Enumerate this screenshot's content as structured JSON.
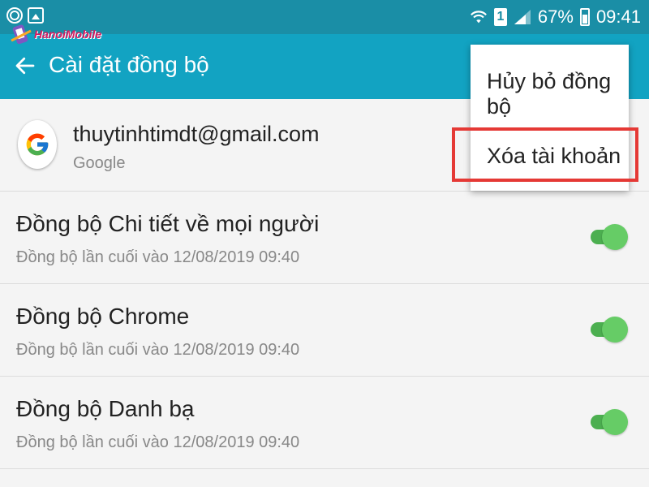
{
  "status_bar": {
    "sim_label": "1",
    "battery": "67%",
    "time": "09:41"
  },
  "watermark": {
    "text": "HanoiMobile"
  },
  "toolbar": {
    "title": "Cài đặt đồng bộ"
  },
  "account": {
    "email": "thuytinhtimdt@gmail.com",
    "type": "Google"
  },
  "sync_items": [
    {
      "title": "Đồng bộ Chi tiết về mọi người",
      "last_sync": "Đồng bộ lần cuối vào 12/08/2019  09:40",
      "enabled": true
    },
    {
      "title": "Đồng bộ Chrome",
      "last_sync": "Đồng bộ lần cuối vào 12/08/2019  09:40",
      "enabled": true
    },
    {
      "title": "Đồng bộ Danh bạ",
      "last_sync": "Đồng bộ lần cuối vào 12/08/2019  09:40",
      "enabled": true
    }
  ],
  "menu": {
    "cancel_sync": "Hủy bỏ đồng bộ",
    "remove_account": "Xóa tài khoản"
  },
  "colors": {
    "status_bar": "#1a8ea6",
    "toolbar": "#12a3c2",
    "toggle_on": "#66cc66",
    "highlight": "#e53935"
  }
}
